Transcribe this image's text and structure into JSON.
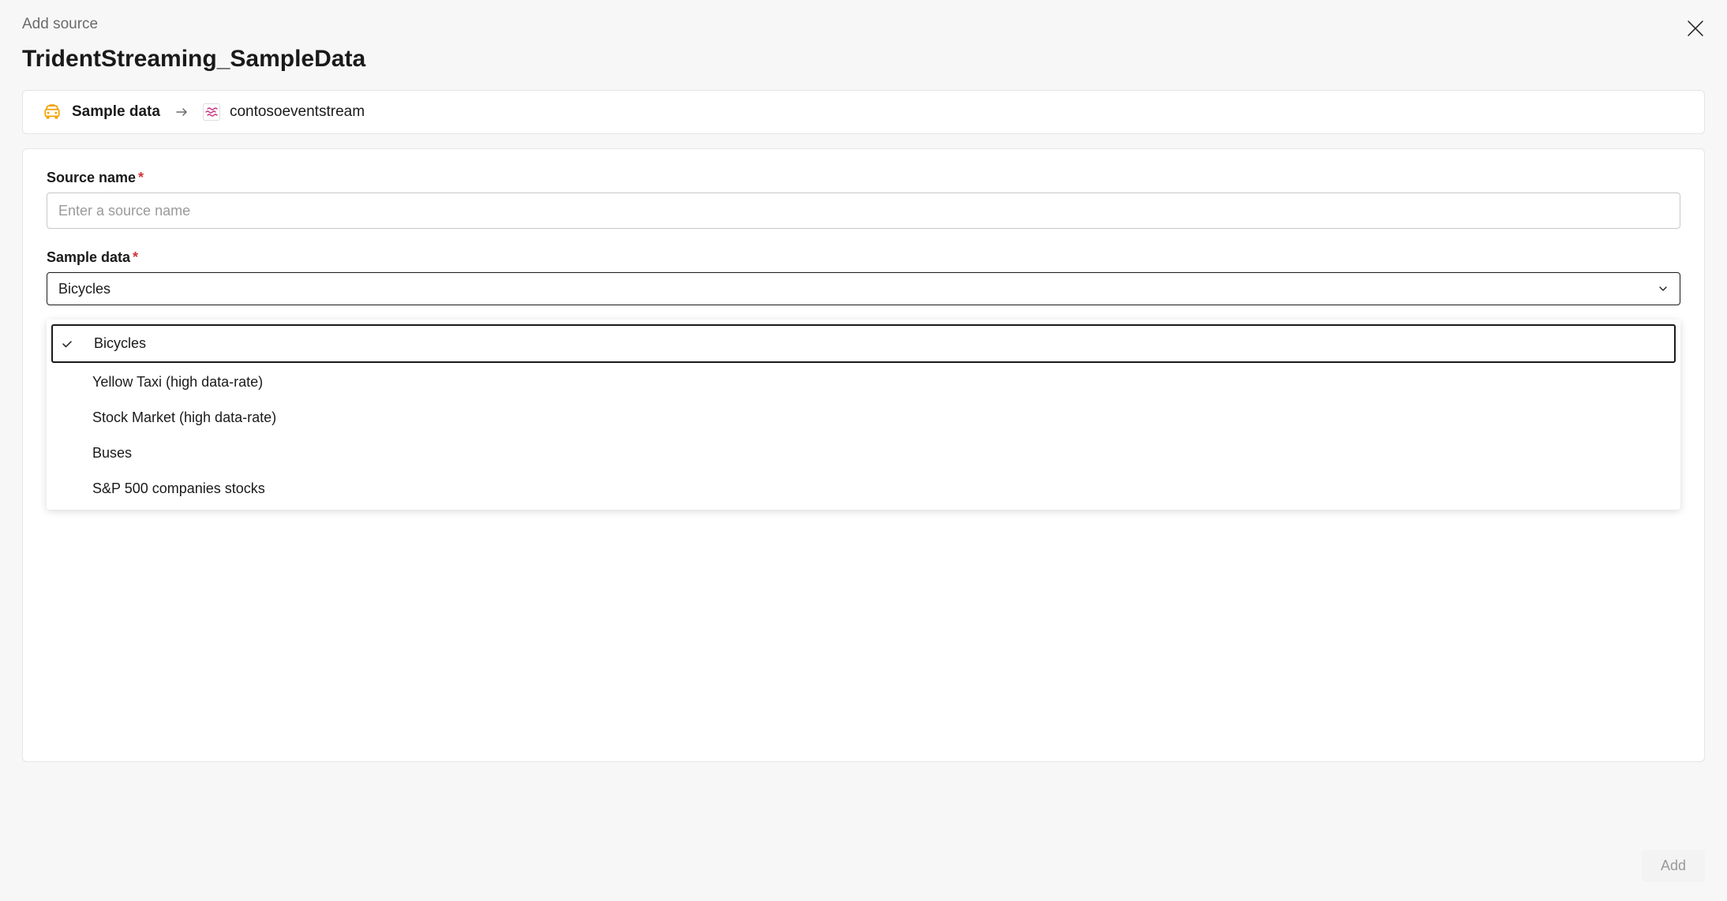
{
  "header": {
    "label": "Add source",
    "title": "TridentStreaming_SampleData"
  },
  "breadcrumb": {
    "source_label": "Sample data",
    "destination_label": "contosoeventstream"
  },
  "form": {
    "source_name": {
      "label": "Source name",
      "placeholder": "Enter a source name",
      "value": ""
    },
    "sample_data": {
      "label": "Sample data",
      "selected": "Bicycles",
      "options": [
        "Bicycles",
        "Yellow Taxi (high data-rate)",
        "Stock Market (high data-rate)",
        "Buses",
        "S&P 500 companies stocks"
      ]
    }
  },
  "footer": {
    "add_label": "Add"
  }
}
